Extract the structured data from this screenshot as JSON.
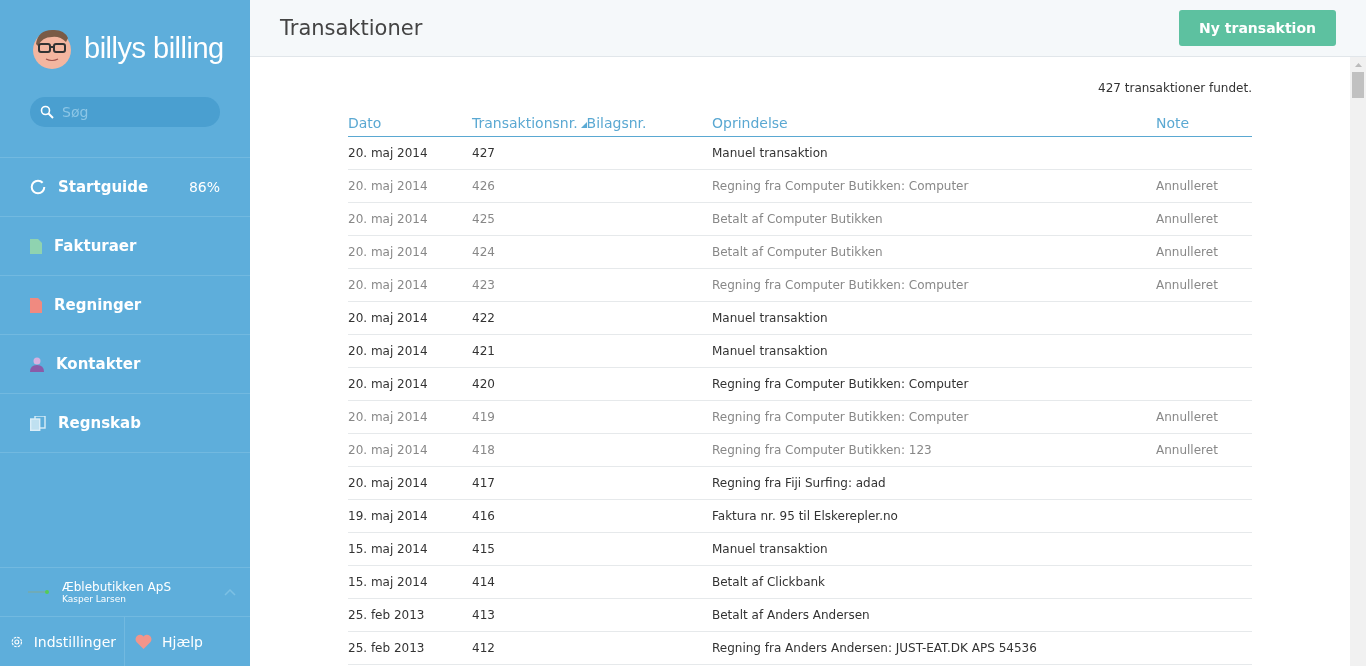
{
  "sidebar": {
    "logo_text": "billys billing",
    "search": {
      "placeholder": "Søg"
    },
    "items": [
      {
        "kind": "progress",
        "label": "Startguide",
        "value": "86%"
      },
      {
        "kind": "invoices",
        "label": "Fakturaer"
      },
      {
        "kind": "bills",
        "label": "Regninger"
      },
      {
        "kind": "contacts",
        "label": "Kontakter"
      },
      {
        "kind": "accounting",
        "label": "Regnskab"
      }
    ],
    "account": {
      "company": "Æblebutikken ApS",
      "user": "Kasper Larsen"
    },
    "footer": [
      {
        "kind": "settings",
        "label": "Indstillinger"
      },
      {
        "kind": "help",
        "label": "Hjælp"
      }
    ]
  },
  "header": {
    "title": "Transaktioner",
    "button": "Ny transaktion"
  },
  "count": "427 transaktioner fundet.",
  "table": {
    "columns": [
      {
        "label": "Dato",
        "sorted": false
      },
      {
        "label": "Transaktionsnr.",
        "sorted": true
      },
      {
        "label": "Bilagsnr.",
        "sorted": false
      },
      {
        "label": "Oprindelse",
        "sorted": false
      },
      {
        "label": "Note",
        "sorted": false
      }
    ],
    "rows": [
      {
        "date": "20. maj 2014",
        "number": "427",
        "origin": "Manuel transaktion",
        "voided": false
      },
      {
        "date": "20. maj 2014",
        "number": "426",
        "origin": "Regning fra Computer Butikken: Computer",
        "note": "Annulleret",
        "voided": true
      },
      {
        "date": "20. maj 2014",
        "number": "425",
        "origin": "Betalt af Computer Butikken",
        "note": "Annulleret",
        "voided": true
      },
      {
        "date": "20. maj 2014",
        "number": "424",
        "origin": "Betalt af Computer Butikken",
        "note": "Annulleret",
        "voided": true
      },
      {
        "date": "20. maj 2014",
        "number": "423",
        "origin": "Regning fra Computer Butikken: Computer",
        "note": "Annulleret",
        "voided": true
      },
      {
        "date": "20. maj 2014",
        "number": "422",
        "origin": "Manuel transaktion",
        "voided": false
      },
      {
        "date": "20. maj 2014",
        "number": "421",
        "origin": "Manuel transaktion",
        "voided": false
      },
      {
        "date": "20. maj 2014",
        "number": "420",
        "origin": "Regning fra Computer Butikken: Computer",
        "voided": false
      },
      {
        "date": "20. maj 2014",
        "number": "419",
        "origin": "Regning fra Computer Butikken: Computer",
        "note": "Annulleret",
        "voided": true
      },
      {
        "date": "20. maj 2014",
        "number": "418",
        "origin": "Regning fra Computer Butikken: 123",
        "note": "Annulleret",
        "voided": true
      },
      {
        "date": "20. maj 2014",
        "number": "417",
        "origin": "Regning fra Fiji Surfing: adad",
        "voided": false
      },
      {
        "date": "19. maj 2014",
        "number": "416",
        "origin": "Faktura nr. 95 til Elskerepler.no",
        "voided": false
      },
      {
        "date": "15. maj 2014",
        "number": "415",
        "origin": "Manuel transaktion",
        "voided": false
      },
      {
        "date": "15. maj 2014",
        "number": "414",
        "origin": "Betalt af Clickbank",
        "voided": false
      },
      {
        "date": "25. feb 2013",
        "number": "413",
        "origin": "Betalt af Anders Andersen",
        "voided": false
      },
      {
        "date": "25. feb 2013",
        "number": "412",
        "origin": "Regning fra Anders Andersen: JUST-EAT.DK APS 54536",
        "voided": false
      }
    ]
  }
}
